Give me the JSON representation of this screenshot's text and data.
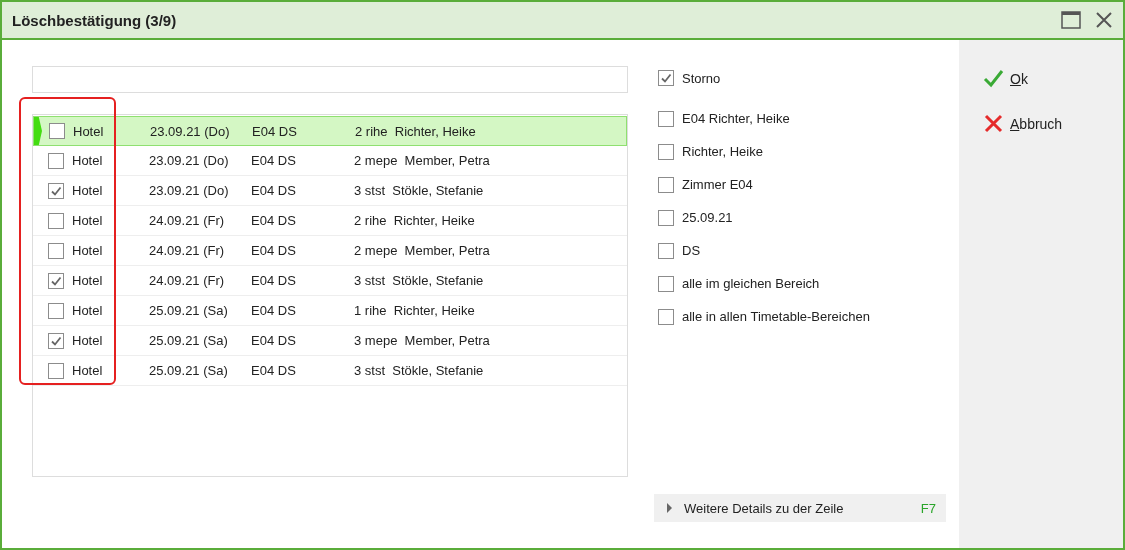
{
  "window": {
    "title": "Löschbestätigung (3/9)"
  },
  "highlight_first_column": true,
  "rows": [
    {
      "checked": false,
      "selected": true,
      "category": "Hotel",
      "date": "23.09.21 (Do)",
      "room": "E04 DS",
      "guest": "2 rihe  Richter, Heike"
    },
    {
      "checked": false,
      "selected": false,
      "category": "Hotel",
      "date": "23.09.21 (Do)",
      "room": "E04 DS",
      "guest": "2 mepe  Member, Petra"
    },
    {
      "checked": true,
      "selected": false,
      "category": "Hotel",
      "date": "23.09.21 (Do)",
      "room": "E04 DS",
      "guest": "3 stst  Stökle, Stefanie"
    },
    {
      "checked": false,
      "selected": false,
      "category": "Hotel",
      "date": "24.09.21 (Fr)",
      "room": "E04 DS",
      "guest": "2 rihe  Richter, Heike"
    },
    {
      "checked": false,
      "selected": false,
      "category": "Hotel",
      "date": "24.09.21 (Fr)",
      "room": "E04 DS",
      "guest": "2 mepe  Member, Petra"
    },
    {
      "checked": true,
      "selected": false,
      "category": "Hotel",
      "date": "24.09.21 (Fr)",
      "room": "E04 DS",
      "guest": "3 stst  Stökle, Stefanie"
    },
    {
      "checked": false,
      "selected": false,
      "category": "Hotel",
      "date": "25.09.21 (Sa)",
      "room": "E04 DS",
      "guest": "1 rihe  Richter, Heike"
    },
    {
      "checked": true,
      "selected": false,
      "category": "Hotel",
      "date": "25.09.21 (Sa)",
      "room": "E04 DS",
      "guest": "3 mepe  Member, Petra"
    },
    {
      "checked": false,
      "selected": false,
      "category": "Hotel",
      "date": "25.09.21 (Sa)",
      "room": "E04 DS",
      "guest": "3 stst  Stökle, Stefanie"
    }
  ],
  "storno": {
    "label": "Storno",
    "checked": true
  },
  "options": [
    {
      "label": "E04 Richter, Heike",
      "checked": false
    },
    {
      "label": "Richter, Heike",
      "checked": false
    },
    {
      "label": "Zimmer E04",
      "checked": false
    },
    {
      "label": "25.09.21",
      "checked": false
    },
    {
      "label": "DS",
      "checked": false
    },
    {
      "label": "alle im gleichen Bereich",
      "checked": false
    },
    {
      "label": "alle in allen Timetable-Bereichen",
      "checked": false
    }
  ],
  "details": {
    "label": "Weitere Details zu der Zeile",
    "shortcut": "F7",
    "expanded": false
  },
  "buttons": [
    {
      "kind": "ok",
      "label": "Ok"
    },
    {
      "kind": "cancel",
      "label": "Abbruch"
    }
  ]
}
